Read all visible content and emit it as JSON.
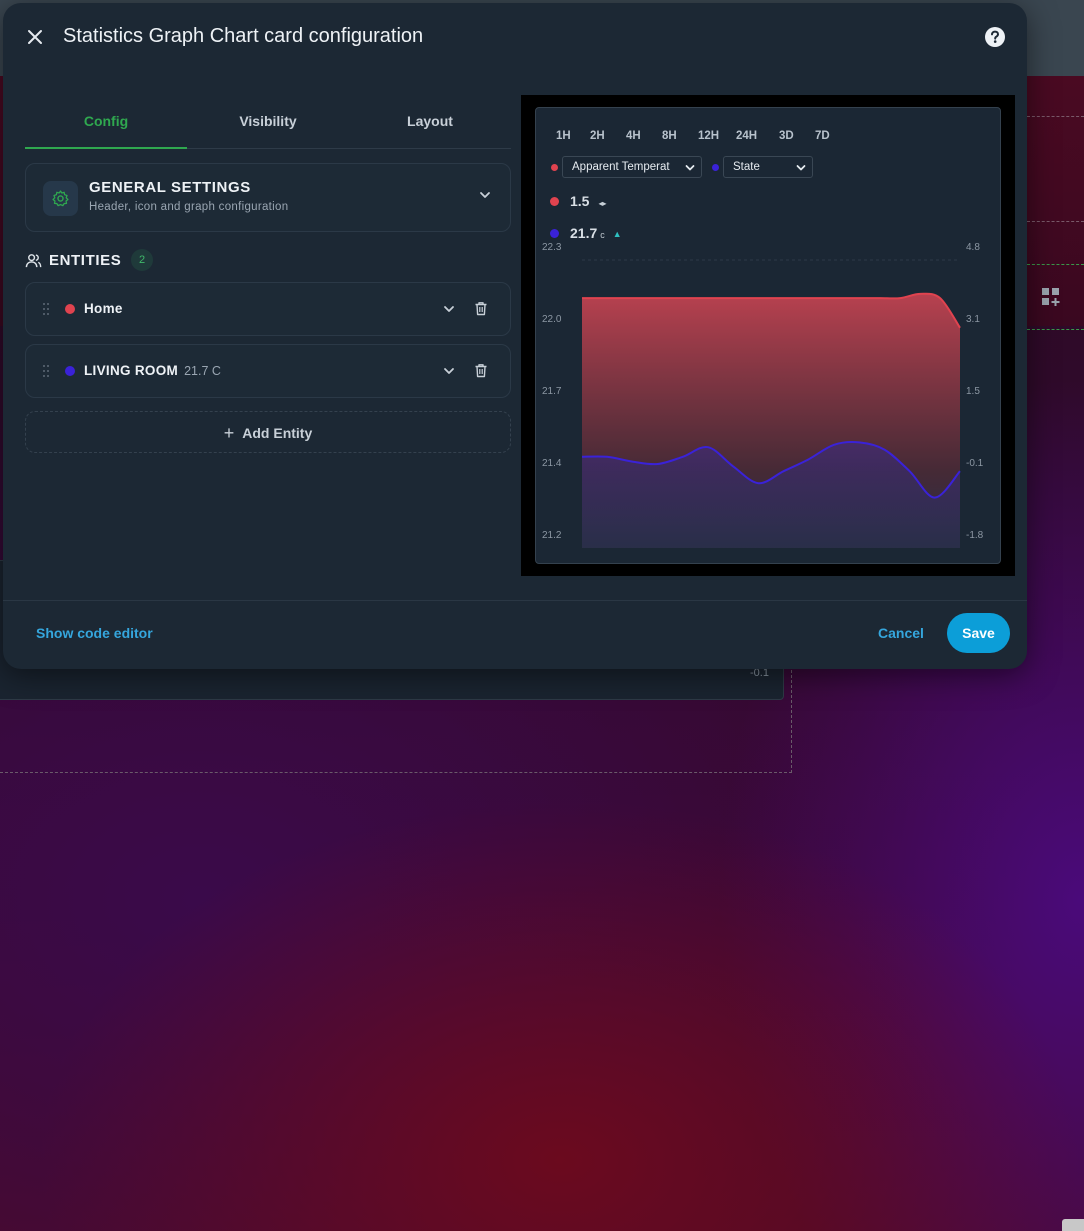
{
  "dialog": {
    "title": "Statistics Graph Chart card configuration",
    "close_icon": "close-icon",
    "help_icon": "help-circle-icon"
  },
  "tabs": [
    {
      "label": "Config",
      "active": true
    },
    {
      "label": "Visibility",
      "active": false
    },
    {
      "label": "Layout",
      "active": false
    }
  ],
  "general_settings": {
    "title": "GENERAL SETTINGS",
    "subtitle": "Header, icon and graph configuration",
    "icon": "gear-icon"
  },
  "entities": {
    "title": "ENTITIES",
    "count": "2",
    "items": [
      {
        "name": "Home",
        "value": "",
        "color": "#e0434f"
      },
      {
        "name": "LIVING ROOM",
        "value": "21.7 C",
        "color": "#3a22d8"
      }
    ],
    "add_label": "Add Entity"
  },
  "preview": {
    "ranges": [
      "1H",
      "2H",
      "4H",
      "8H",
      "12H",
      "24H",
      "3D",
      "7D"
    ],
    "selects": [
      {
        "value": "Apparent Temperat",
        "color": "#e0434f"
      },
      {
        "value": "State",
        "color": "#3a22d8"
      }
    ],
    "legend": [
      {
        "value": "1.5",
        "unit": "",
        "indicator": "◂▸",
        "color": "#e0434f"
      },
      {
        "value": "21.7",
        "unit": "c",
        "indicator": "▲",
        "color": "#3a22d8"
      }
    ]
  },
  "chart_data": {
    "type": "area",
    "left_axis_ticks": [
      "22.3",
      "22.0",
      "21.7",
      "21.4",
      "21.2"
    ],
    "right_axis_ticks": [
      "4.8",
      "3.1",
      "1.5",
      "-0.1",
      "-1.8"
    ],
    "series": [
      {
        "name": "Apparent Temperat",
        "color": "#e0434f",
        "axis": "right",
        "values": [
          3.9,
          3.9,
          3.9,
          3.9,
          3.9,
          3.9,
          3.9,
          3.9,
          3.9,
          3.9,
          3.9,
          3.9,
          3.9,
          3.9,
          3.9,
          3.9,
          3.9,
          4.0,
          3.9,
          3.2
        ]
      },
      {
        "name": "State",
        "color": "#3a22d8",
        "axis": "left",
        "values": [
          21.48,
          21.48,
          21.46,
          21.45,
          21.48,
          21.52,
          21.44,
          21.38,
          21.42,
          21.47,
          21.53,
          21.54,
          21.51,
          21.42,
          21.34,
          21.42
        ]
      }
    ]
  },
  "footer": {
    "code_editor_label": "Show code editor",
    "cancel_label": "Cancel",
    "save_label": "Save"
  },
  "background": {
    "axis_label": "-0.1"
  }
}
